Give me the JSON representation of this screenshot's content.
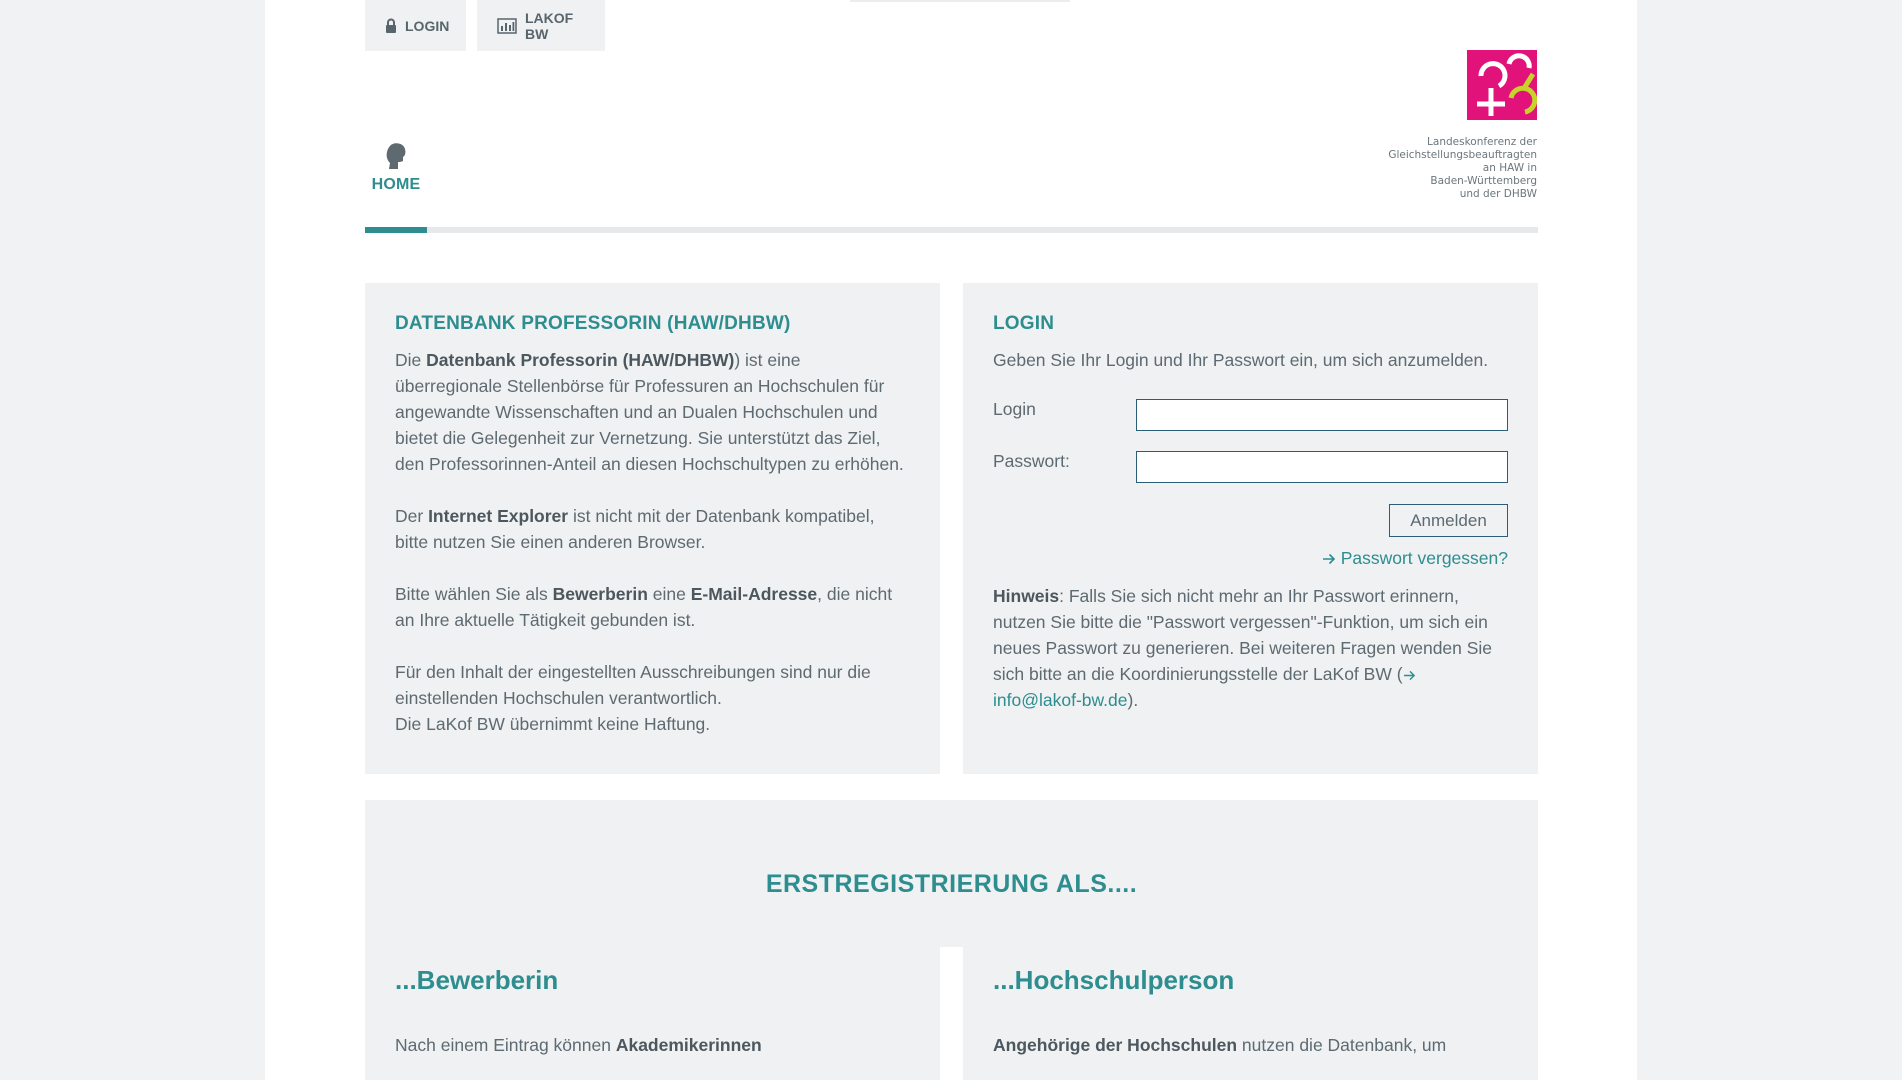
{
  "topnav": {
    "login_label": "LOGIN",
    "lakof_label": "LAKOF BW"
  },
  "logo": {
    "text": "Landeskonferenz der\nGleichstellungsbeauftragten\nan HAW in\nBaden-Württemberg\nund der DHBW",
    "color": "#e2127b"
  },
  "mainnav": {
    "home_label": "HOME",
    "accent": "#2e8d8f"
  },
  "info": {
    "title": "DATENBANK PROFESSORIN (HAW/DHBW)",
    "p1_pre": "Die ",
    "p1_bold": "Datenbank Professorin (HAW/DHBW)",
    "p1_post": ") ist eine überregionale Stellenbörse für Professuren an Hochschulen für angewandte Wissenschaften und an Dualen Hochschulen und bietet die Gelegenheit zur Vernetzung. Sie unterstützt das Ziel, den Professorinnen-Anteil an diesen Hochschultypen zu erhöhen.",
    "p2_pre": "Der ",
    "p2_bold": "Internet Explorer",
    "p2_post": " ist nicht mit der Datenbank kompatibel, bitte nutzen Sie einen anderen Browser.",
    "p3_pre": "Bitte wählen Sie als ",
    "p3_bold1": "Bewerberin",
    "p3_mid": " eine ",
    "p3_bold2": "E-Mail-Adresse",
    "p3_post": ", die nicht an Ihre aktuelle Tätigkeit gebunden ist.",
    "p4_line1": "Für den Inhalt der eingestellten Ausschreibungen sind nur die einstellenden Hochschulen verantwortlich.",
    "p4_line2": "Die LaKof BW übernimmt keine Haftung."
  },
  "login": {
    "title": "LOGIN",
    "intro": "Geben Sie Ihr Login und Ihr Passwort ein, um sich anzumelden.",
    "login_label": "Login",
    "login_value": "",
    "password_label": "Passwort:",
    "password_value": "",
    "submit_label": "Anmelden",
    "forgot_label": "Passwort vergessen?",
    "hint_bold": "Hinweis",
    "hint_text": ": Falls Sie sich nicht mehr an Ihr Passwort erinnern, nutzen Sie bitte die \"Passwort vergessen\"-Funktion, um sich ein neues Passwort zu generieren. Bei weiteren Fragen wenden Sie sich bitte an die Koordinierungsstelle der LaKof BW (",
    "hint_link": "info@lakof-bw.de",
    "hint_end": ")."
  },
  "registration": {
    "title": "ERSTREGISTRIERUNG ALS....",
    "left_heading": "...Bewerberin",
    "left_pre": "Nach einem Eintrag können ",
    "left_bold": "Akademikerinnen",
    "right_heading": "...Hochschulperson",
    "right_bold": "Angehörige der Hochschulen",
    "right_post": " nutzen die Datenbank, um"
  }
}
